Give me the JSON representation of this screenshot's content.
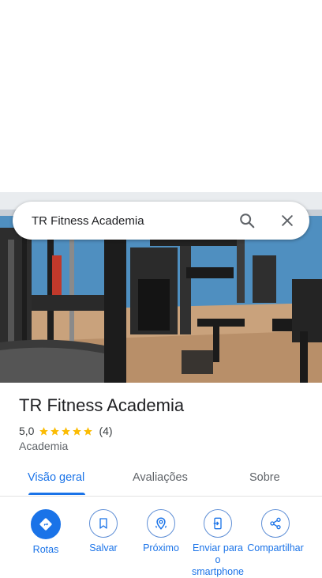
{
  "search": {
    "query": "TR Fitness Academia"
  },
  "place": {
    "name": "TR Fitness Academia",
    "rating": "5,0",
    "stars": 5,
    "review_count": "(4)",
    "category": "Academia"
  },
  "tabs": [
    {
      "label": "Visão geral",
      "active": true
    },
    {
      "label": "Avaliações",
      "active": false
    },
    {
      "label": "Sobre",
      "active": false
    }
  ],
  "actions": [
    {
      "label": "Rotas",
      "icon": "directions-icon"
    },
    {
      "label": "Salvar",
      "icon": "bookmark-icon"
    },
    {
      "label": "Próximo",
      "icon": "nearby-icon"
    },
    {
      "label": "Enviar para o smartphone",
      "icon": "send-to-phone-icon"
    },
    {
      "label": "Compartilhar",
      "icon": "share-icon"
    }
  ],
  "colors": {
    "accent": "#1a73e8",
    "star": "#fbbc04"
  }
}
